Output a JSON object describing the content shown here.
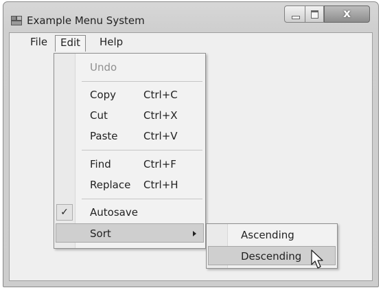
{
  "window": {
    "title": "Example Menu System",
    "close_glyph": "x"
  },
  "menubar": {
    "file": "File",
    "edit": "Edit",
    "help": "Help"
  },
  "edit_menu": {
    "undo": "Undo",
    "copy": "Copy",
    "copy_sc": "Ctrl+C",
    "cut": "Cut",
    "cut_sc": "Ctrl+X",
    "paste": "Paste",
    "paste_sc": "Ctrl+V",
    "find": "Find",
    "find_sc": "Ctrl+F",
    "replace": "Replace",
    "replace_sc": "Ctrl+H",
    "autosave": "Autosave",
    "autosave_checked": true,
    "check_glyph": "✓",
    "sort": "Sort"
  },
  "sort_menu": {
    "ascending": "Ascending",
    "descending": "Descending"
  },
  "icons": [
    "app-icon",
    "minimize-icon",
    "maximize-icon",
    "close-icon",
    "checkmark-icon",
    "submenu-arrow-icon",
    "mouse-cursor-icon"
  ]
}
